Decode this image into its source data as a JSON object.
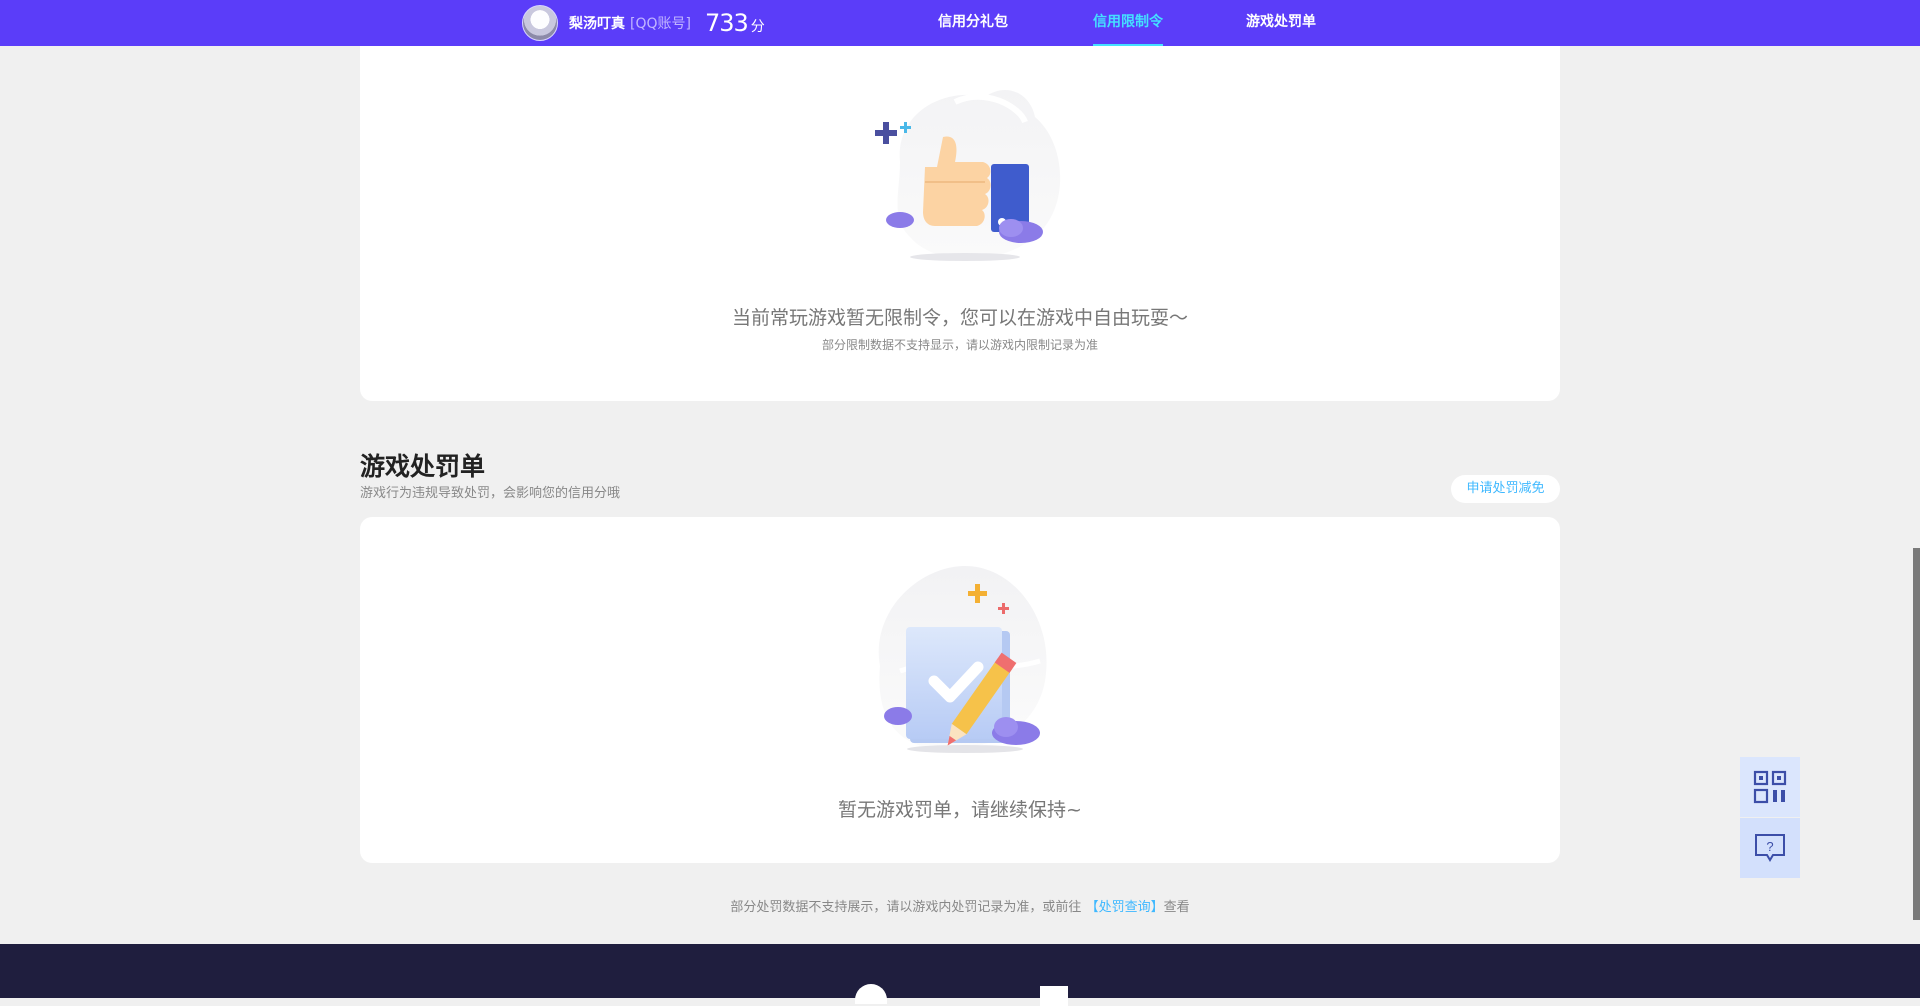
{
  "header": {
    "username": "梨汤叮真",
    "account_type": "[QQ账号]",
    "score": "733",
    "score_unit": "分",
    "tabs": [
      {
        "label": "信用分礼包",
        "active": false
      },
      {
        "label": "信用限制令",
        "active": true
      },
      {
        "label": "游戏处罚单",
        "active": false
      }
    ]
  },
  "restriction": {
    "empty_title": "当前常玩游戏暂无限制令，您可以在游戏中自由玩耍～",
    "empty_note": "部分限制数据不支持显示，请以游戏内限制记录为准"
  },
  "penalty": {
    "title": "游戏处罚单",
    "description": "游戏行为违规导致处罚，会影响您的信用分哦",
    "appeal_button": "申请处罚减免",
    "empty_title": "暂无游戏罚单，请继续保持~",
    "footnote_before": "部分处罚数据不支持展示，请以游戏内处罚记录为准，或前往",
    "footnote_link": "【处罚查询】",
    "footnote_after": "查看"
  },
  "colors": {
    "nav_bg": "#5b3df9",
    "active_tab": "#44e0ff",
    "link": "#3eb8ff",
    "footer_bg": "#1f1e3e"
  },
  "icons": {
    "side_top": "qr-code-icon",
    "side_bottom": "help-chat-icon"
  }
}
